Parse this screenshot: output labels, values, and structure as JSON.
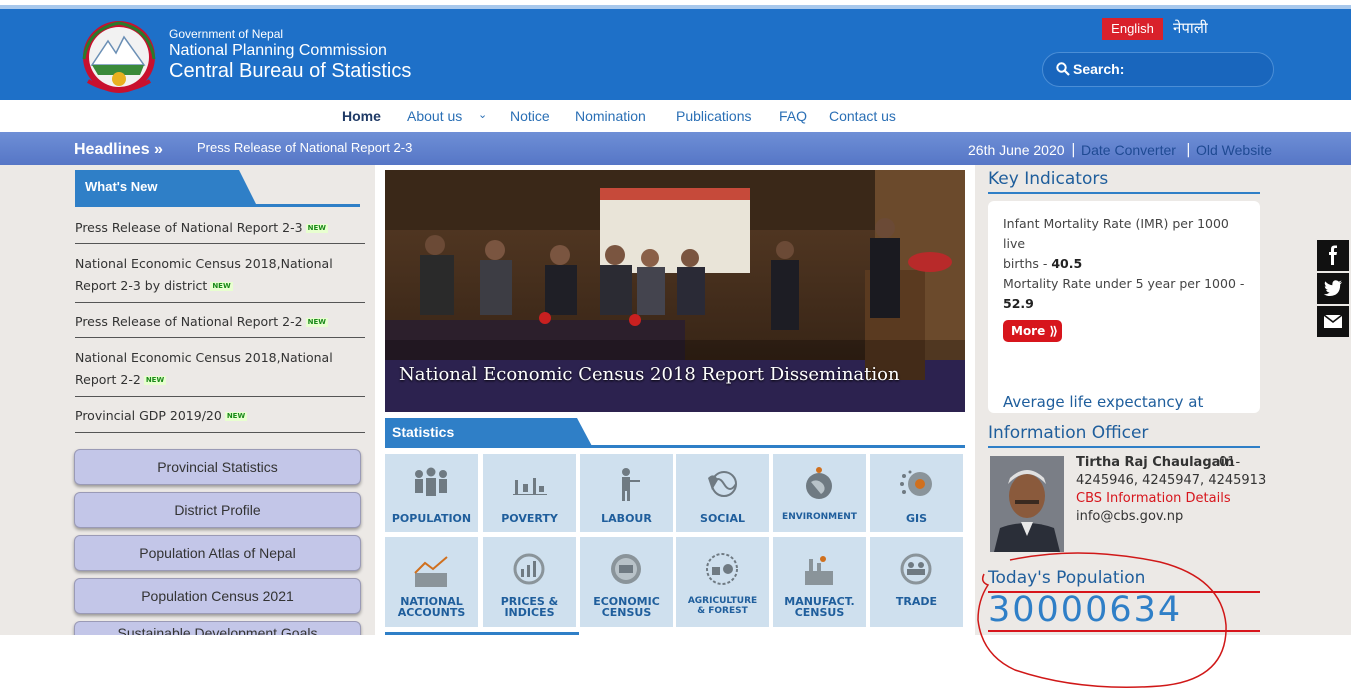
{
  "header": {
    "gov_line1": "Government of Nepal",
    "gov_line2": "National Planning Commission",
    "gov_line3": "Central Bureau of Statistics",
    "lang_english": "English",
    "lang_nepali": "नेपाली",
    "search_label": "Search:"
  },
  "nav": {
    "items": [
      "Home",
      "About us",
      "Notice",
      "Nomination",
      "Publications",
      "FAQ",
      "Contact us"
    ]
  },
  "headline": {
    "title": "Headlines »",
    "text": "Press Release of National Report 2-3",
    "date": "26th June 2020",
    "sep": "|",
    "link1": "Date Converter",
    "link2": "Old Website"
  },
  "whats_new": {
    "title": "What's New",
    "badge": "NEW",
    "items": [
      {
        "line1": "Press Release of National Report 2-3",
        "line2": ""
      },
      {
        "line1": "National Economic Census 2018,National",
        "line2": "Report 2-3 by district"
      },
      {
        "line1": "Press Release of National Report 2-2",
        "line2": ""
      },
      {
        "line1": "National Economic Census 2018,National",
        "line2": "Report 2-2"
      },
      {
        "line1": "Provincial GDP 2019/20",
        "line2": ""
      }
    ]
  },
  "side_buttons": [
    "Provincial Statistics",
    "District Profile",
    "Population Atlas of Nepal",
    "Population Census 2021",
    "Sustainable Development Goals"
  ],
  "hero": {
    "caption": "National Economic Census 2018 Report Dissemination"
  },
  "statistics": {
    "title": "Statistics",
    "tiles": [
      {
        "l1": "POPULATION",
        "l2": "",
        "icon": "population-icon"
      },
      {
        "l1": "POVERTY",
        "l2": "",
        "icon": "poverty-icon"
      },
      {
        "l1": "LABOUR",
        "l2": "",
        "icon": "labour-icon"
      },
      {
        "l1": "SOCIAL",
        "l2": "",
        "icon": "social-icon"
      },
      {
        "l1": "ENVIRONMENT",
        "l2": "",
        "icon": "environment-icon"
      },
      {
        "l1": "GIS",
        "l2": "",
        "icon": "gis-icon"
      },
      {
        "l1": "NATIONAL",
        "l2": "ACCOUNTS",
        "icon": "national-accounts-icon"
      },
      {
        "l1": "PRICES &",
        "l2": "INDICES",
        "icon": "prices-icon"
      },
      {
        "l1": "ECONOMIC",
        "l2": "CENSUS",
        "icon": "economic-census-icon"
      },
      {
        "l1": "AGRICULTURE",
        "l2": "& FOREST",
        "icon": "agriculture-icon"
      },
      {
        "l1": "MANUFACT.",
        "l2": "CENSUS",
        "icon": "manufacture-icon"
      },
      {
        "l1": "TRADE",
        "l2": "",
        "icon": "trade-icon"
      }
    ]
  },
  "key_indicators": {
    "title": "Key Indicators",
    "imr_label1": "Infant Mortality Rate (IMR) per 1000 live",
    "imr_label2": "births - ",
    "imr_value": "40.5",
    "u5_label": "Mortality Rate under 5 year per 1000 -",
    "u5_value": "52.9",
    "more": "More ⟫",
    "next_title": "Average life expectancy at"
  },
  "information_officer": {
    "title": "Information Officer",
    "name": "Tirtha Raj Chaulagain",
    "phone1": "01-",
    "phone2": "4245946, 4245947, 4245913",
    "details_link": "CBS Information Details",
    "email": "info@cbs.gov.np"
  },
  "population": {
    "title": "Today's Population",
    "value": "30000634"
  },
  "colors": {
    "header_blue": "#1e70c8",
    "accent_blue": "#2f7fc7",
    "red": "#d7151c",
    "headline_bar": "#5f7fcc"
  }
}
